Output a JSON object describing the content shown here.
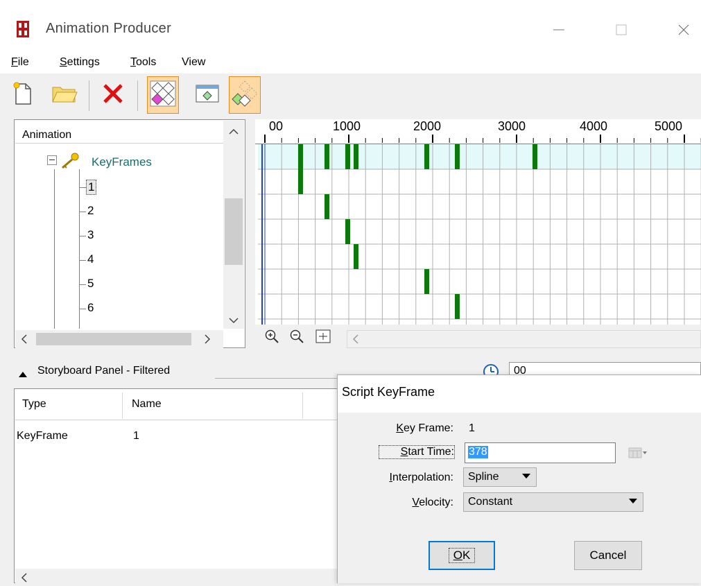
{
  "window": {
    "title": "Animation Producer"
  },
  "menu": {
    "items": [
      {
        "label": "File",
        "accel": "F",
        "rest": "ile"
      },
      {
        "label": "Settings",
        "accel": "S",
        "rest": "ettings"
      },
      {
        "label": "Tools",
        "accel": "T",
        "rest": "ools"
      },
      {
        "label": "View",
        "accel": "",
        "rest": "View"
      }
    ]
  },
  "toolbar": {
    "buttons": [
      {
        "icon": "new-document-icon",
        "pressed": false
      },
      {
        "icon": "open-folder-icon",
        "pressed": false
      },
      {
        "icon": "delete-icon",
        "pressed": false
      },
      {
        "icon": "keyframes-view-icon",
        "pressed": true
      },
      {
        "icon": "keyframe-window-icon",
        "pressed": false
      },
      {
        "icon": "keyframe-schedule-icon",
        "pressed": true
      }
    ]
  },
  "tree": {
    "header": "Animation",
    "root": {
      "label": "KeyFrames",
      "icon": "key-icon",
      "expander": "minus"
    },
    "items": [
      "1",
      "2",
      "3",
      "4",
      "5",
      "6"
    ],
    "selected": "1"
  },
  "timeline": {
    "ruler_labels": [
      "00",
      "1000",
      "2000",
      "3000",
      "4000",
      "5000"
    ]
  },
  "storyboard": {
    "title": "Storyboard Panel - Filtered",
    "columns": [
      "Type",
      "Name"
    ],
    "rows": [
      {
        "type": "KeyFrame",
        "name": "1"
      }
    ],
    "time_value": "00"
  },
  "dialog": {
    "title": "Script KeyFrame",
    "keyframe_label": "Key Frame:",
    "keyframe_value": "1",
    "start_time_label": "Start Time:",
    "start_time_value": "378",
    "interpolation_label": "Interpolation:",
    "interpolation_value": "Spline",
    "velocity_label": "Velocity:",
    "velocity_value": "Constant",
    "ok_label": "OK",
    "cancel_label": "Cancel"
  },
  "colors": {
    "keyframe_marker": "#0b7a0b",
    "current_time_line": "#1f3fd6",
    "track_highlight": "#e3f9fa",
    "pressed_button": "#ffd9a3",
    "selection": "#3399ff"
  }
}
